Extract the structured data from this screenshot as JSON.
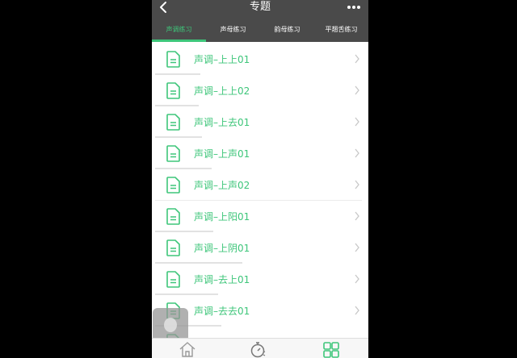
{
  "header": {
    "title": "专题"
  },
  "tabs": [
    {
      "label": "声调练习",
      "active": true
    },
    {
      "label": "声母练习",
      "active": false
    },
    {
      "label": "韵母练习",
      "active": false
    },
    {
      "label": "平翘舌练习",
      "active": false
    }
  ],
  "list": {
    "items": [
      {
        "label": "声调–上上01"
      },
      {
        "label": "声调–上上02"
      },
      {
        "label": "声调–上去01"
      },
      {
        "label": "声调–上声01"
      },
      {
        "label": "声调–上声02"
      },
      {
        "label": "声调–上阳01"
      },
      {
        "label": "声调–上阴01"
      },
      {
        "label": "声调–去上01"
      },
      {
        "label": "声调–去去01"
      }
    ]
  },
  "icons": {
    "back": "chevron-left-icon",
    "menu": "more-dots-icon",
    "item": "document-icon",
    "row_arrow": "chevron-right-icon",
    "home": "home-icon",
    "timer": "stopwatch-icon",
    "grid": "grid-icon"
  },
  "colors": {
    "accent": "#3ec67a",
    "header_bg": "#4a4a4a",
    "list_bg": "#ffffff"
  }
}
